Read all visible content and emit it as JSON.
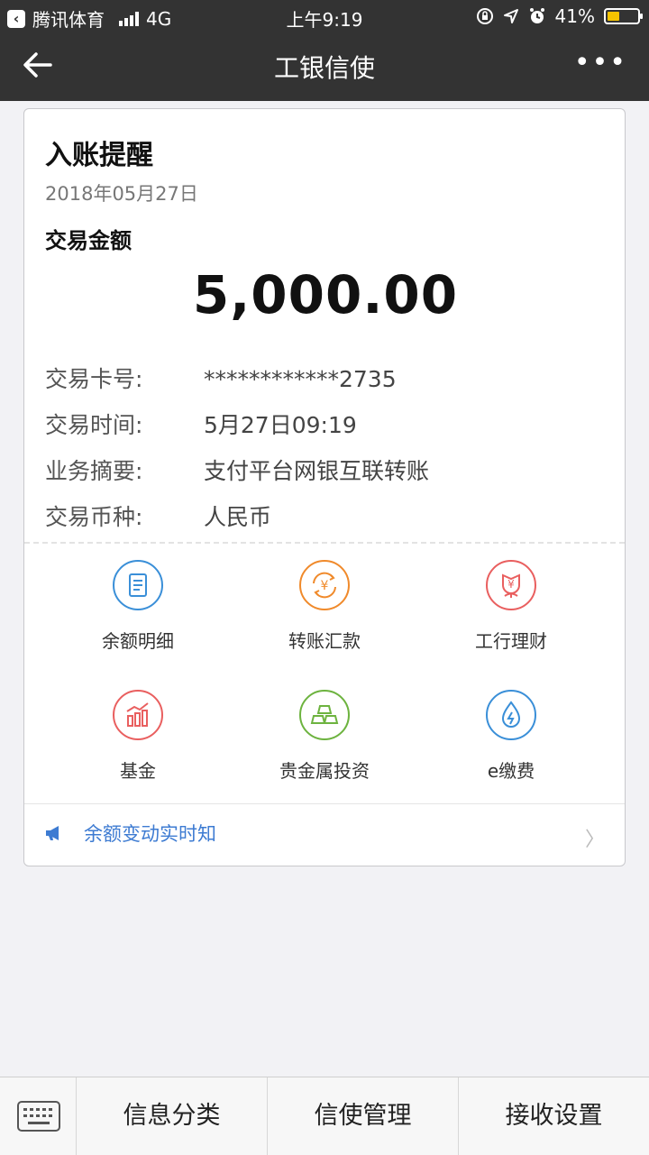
{
  "status_bar": {
    "carrier_app": "腾讯体育",
    "network": "4G",
    "time": "上午9:19",
    "battery": "41%",
    "battery_level": 0.41,
    "battery_color": "#f5c400"
  },
  "nav": {
    "title": "工银信使",
    "more_label": "•••"
  },
  "message": {
    "title": "入账提醒",
    "date": "2018年05月27日",
    "amount_label": "交易金额",
    "amount": "5,000.00",
    "details": [
      {
        "key": "交易卡号:",
        "value": "************2735"
      },
      {
        "key": "交易时间:",
        "value": "5月27日09:19"
      },
      {
        "key": "业务摘要:",
        "value": "支付平台网银互联转账"
      },
      {
        "key": "交易币种:",
        "value": "人民币"
      }
    ]
  },
  "services": [
    {
      "label": "余额明细",
      "icon": "document-icon",
      "color": "#3a8fd8"
    },
    {
      "label": "转账汇款",
      "icon": "transfer-yuan-icon",
      "color": "#f08a2b"
    },
    {
      "label": "工行理财",
      "icon": "wealth-flower-icon",
      "color": "#e95f5f"
    },
    {
      "label": "基金",
      "icon": "fund-chart-icon",
      "color": "#e95f5f"
    },
    {
      "label": "贵金属投资",
      "icon": "gold-bars-icon",
      "color": "#6db33f"
    },
    {
      "label": "e缴费",
      "icon": "water-drop-icon",
      "color": "#3a8fd8"
    }
  ],
  "notice": {
    "text": "余额变动实时知",
    "chevron": "〉"
  },
  "bottom_tabs": [
    "信息分类",
    "信使管理",
    "接收设置"
  ]
}
